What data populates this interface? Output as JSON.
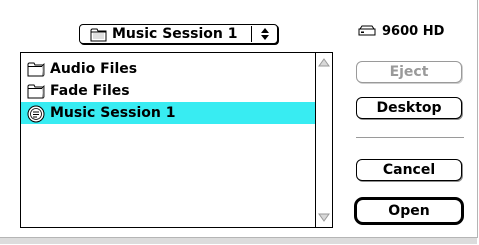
{
  "location_popup": {
    "label": "Music Session 1",
    "icon": "folder-icon"
  },
  "file_list": {
    "items": [
      {
        "label": "Audio Files",
        "icon": "folder-icon",
        "selected": false
      },
      {
        "label": "Fade Files",
        "icon": "folder-icon",
        "selected": false
      },
      {
        "label": "Music Session 1",
        "icon": "session-document-icon",
        "selected": true
      }
    ]
  },
  "disk": {
    "label": "9600 HD",
    "icon": "hard-disk-icon"
  },
  "buttons": {
    "eject": "Eject",
    "desktop": "Desktop",
    "cancel": "Cancel",
    "open": "Open"
  },
  "colors": {
    "selection": "#38ecf2",
    "disabled_text": "#9a9a9a"
  }
}
